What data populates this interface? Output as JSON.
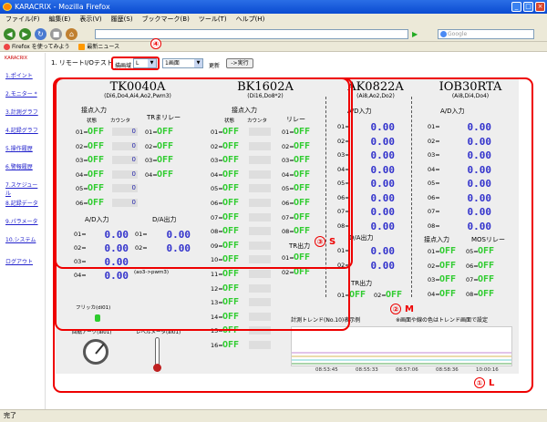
{
  "window": {
    "title": "KARACRIX - Mozilla Firefox"
  },
  "menu": [
    "ファイル(F)",
    "編集(E)",
    "表示(V)",
    "履歴(S)",
    "ブックマーク(B)",
    "ツール(T)",
    "ヘルプ(H)"
  ],
  "search": {
    "placeholder": "Google"
  },
  "bookmarks": [
    {
      "label": "Firefox を使ってみよう"
    },
    {
      "label": "最新ニュース"
    }
  ],
  "sidebar": {
    "brand": "KARACRIX",
    "items": [
      "1.ポイント",
      "2.モニター *",
      "3.計測グラフ",
      "4.記録グラフ",
      "5.操作履歴",
      "6.警報履歴",
      "7.スケジュール",
      "8.記録データ",
      "9.パラメータ",
      "10.システム",
      "ログアウト"
    ]
  },
  "page": {
    "title": "1. リモートI/Oテスト",
    "scale_label": "描画域",
    "scale_value": "L",
    "screen_value": "1画面",
    "update_label": "更新",
    "exec_label": "->実行"
  },
  "devices": {
    "tk": {
      "name": "TK0040A",
      "spec": "(Di6,Do4,Ai4,Ao2,Pwm3)",
      "contact_input": "接点入力",
      "state": "状態",
      "count": "カウンタ",
      "relay": "TRまリレー",
      "di_labels": [
        "01=",
        "02=",
        "03=",
        "04=",
        "05=",
        "06="
      ],
      "di_states": [
        "OFF",
        "OFF",
        "OFF",
        "OFF",
        "OFF",
        "OFF"
      ],
      "di_counts": [
        "0",
        "0",
        "0",
        "0",
        "0",
        "0"
      ],
      "do_labels": [
        "01=",
        "02=",
        "03=",
        "04="
      ],
      "do_states": [
        "OFF",
        "OFF",
        "OFF",
        "OFF"
      ],
      "ai_title": "A/D入力",
      "ao_title": "D/A出力",
      "ai_labels": [
        "01=",
        "02=",
        "03=",
        "04="
      ],
      "ai_values": [
        "0.00",
        "0.00",
        "0.00",
        "0.00"
      ],
      "ao_labels": [
        "01=",
        "02="
      ],
      "ao_values": [
        "0.00",
        "0.00"
      ],
      "ao_note": "(ao3->pwm3)",
      "flicker": "フリッカ(di01)",
      "rotary": "回転アーク(ai01)",
      "level": "レベルメータ(ai01)"
    },
    "bk": {
      "name": "BK1602A",
      "spec": "(Di16,Do8*2)",
      "contact_input": "接点入力",
      "state": "状態",
      "count": "カウンタ",
      "relay": "リレー",
      "di_labels": [
        "01=",
        "02=",
        "03=",
        "04=",
        "05=",
        "06=",
        "07=",
        "08=",
        "09=",
        "10=",
        "11=",
        "12=",
        "13=",
        "14=",
        "15=",
        "16="
      ],
      "di_states": [
        "OFF",
        "OFF",
        "OFF",
        "OFF",
        "OFF",
        "OFF",
        "OFF",
        "OFF",
        "OFF",
        "OFF",
        "OFF",
        "OFF",
        "OFF",
        "OFF",
        "OFF",
        "OFF"
      ],
      "do_labels": [
        "01=",
        "02=",
        "03=",
        "04=",
        "05=",
        "06=",
        "07=",
        "08="
      ],
      "do_states": [
        "OFF",
        "OFF",
        "OFF",
        "OFF",
        "OFF",
        "OFF",
        "OFF",
        "OFF"
      ],
      "tr_title": "TR出力",
      "tr_labels": [
        "01=",
        "02="
      ],
      "tr_states": [
        "OFF",
        "OFF"
      ]
    },
    "ak": {
      "name": "AK0822A",
      "spec": "(Ai8,Ao2,Do2)",
      "ai_title": "A/D入力",
      "ai_labels": [
        "01=",
        "02=",
        "03=",
        "04=",
        "05=",
        "06=",
        "07=",
        "08="
      ],
      "ai_values": [
        "0.00",
        "0.00",
        "0.00",
        "0.00",
        "0.00",
        "0.00",
        "0.00",
        "0.00"
      ],
      "ao_title": "D/A出力",
      "ao_labels": [
        "01=",
        "02="
      ],
      "ao_values": [
        "0.00",
        "0.00"
      ],
      "tr_title": "TR出力",
      "tr_labels": [
        "01=",
        "02="
      ],
      "tr_states": [
        "OFF",
        "OFF"
      ]
    },
    "io": {
      "name": "IOB30RTA",
      "spec": "(Ai8,Di4,Do4)",
      "ai_title": "A/D入力",
      "ai_labels": [
        "01=",
        "02=",
        "03=",
        "04=",
        "05=",
        "06=",
        "07=",
        "08="
      ],
      "ai_values": [
        "0.00",
        "0.00",
        "0.00",
        "0.00",
        "0.00",
        "0.00",
        "0.00",
        "0.00"
      ],
      "di_title": "接点入力",
      "do_title": "MOSリレー",
      "di_labels": [
        "01=",
        "02=",
        "03=",
        "04="
      ],
      "di_states": [
        "OFF",
        "OFF",
        "OFF",
        "OFF"
      ],
      "do_labels": [
        "05=",
        "06=",
        "07=",
        "08="
      ],
      "do_states": [
        "OFF",
        "OFF",
        "OFF",
        "OFF"
      ]
    }
  },
  "trend": {
    "title": "計測トレンド(No.10)表示例",
    "note": "※画面や線の色はトレンド画面で設定",
    "times": [
      "08:53:45",
      "08:55:33",
      "08:57:06",
      "08:58:36",
      "10:00:16"
    ]
  },
  "annotations": {
    "L": {
      "num": "①",
      "text": "L"
    },
    "M": {
      "num": "②",
      "text": "M"
    },
    "S": {
      "num": "③",
      "text": "S"
    },
    "sel": {
      "num": "④"
    }
  },
  "colors": {
    "off": "#2fcc2f",
    "analog": "#3333cc",
    "annotation": "#ee0000"
  },
  "status": "完了"
}
